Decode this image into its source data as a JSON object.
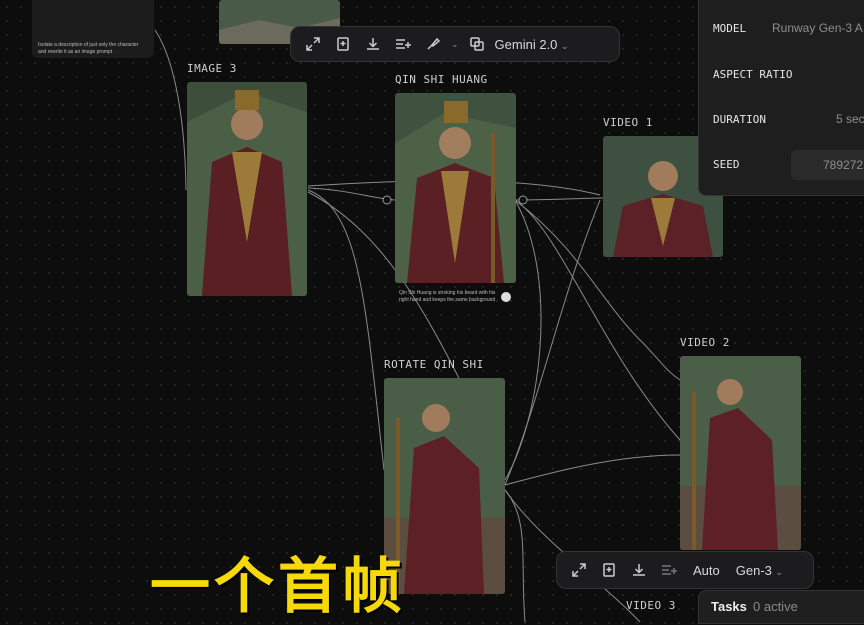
{
  "canvas": {
    "nodes": {
      "image3": {
        "label": "IMAGE 3"
      },
      "qin": {
        "label": "QIN SHI HUANG",
        "prompt": "Qin Shi Huang is stroking his beard with his right hand and keeps the same background"
      },
      "video1": {
        "label": "VIDEO 1"
      },
      "rotate": {
        "label": "ROTATE QIN SHI"
      },
      "video2": {
        "label": "VIDEO 2"
      },
      "video3": {
        "label": "VIDEO 3"
      },
      "topleft": {
        "prompt": "Isolate a description of just only the character and rewrite it as an image prompt"
      }
    }
  },
  "top_toolbar": {
    "model": "Gemini 2.0",
    "icons": [
      "expand-icon",
      "bookmark-icon",
      "download-icon",
      "enhance-icon",
      "brush-icon",
      "copy-icon"
    ]
  },
  "bottom_toolbar": {
    "aspect": "Auto",
    "model": "Gen-3",
    "icons": [
      "expand-icon",
      "bookmark-icon",
      "download-icon",
      "enhance-icon"
    ]
  },
  "settings_panel": {
    "model_label": "MODEL",
    "model_value": "Runway Gen-3 A",
    "aspect_label": "ASPECT RATIO",
    "duration_label": "DURATION",
    "duration_value": "5 sec",
    "seed_label": "SEED",
    "seed_value": "789272"
  },
  "tasks": {
    "label": "Tasks",
    "status": "0 active"
  },
  "caption": "一个首帧",
  "colors": {
    "caption": "#f5d90a",
    "background": "#0d0d0e",
    "panel": "#1e1e1f"
  }
}
